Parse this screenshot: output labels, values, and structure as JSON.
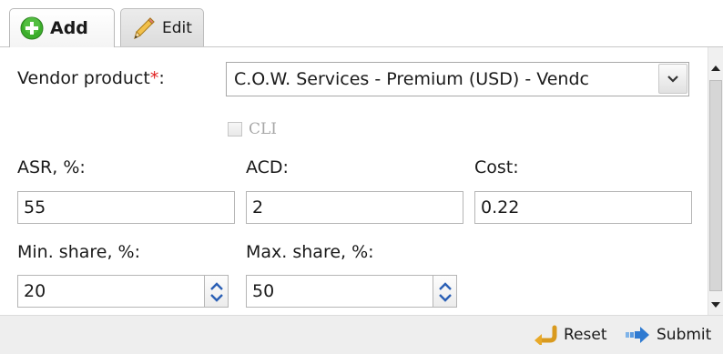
{
  "tabs": {
    "add_label": "Add",
    "edit_label": "Edit",
    "active": "Add"
  },
  "form": {
    "vendor_product": {
      "label": "Vendor product",
      "required_mark": "*",
      "colon": ":",
      "value": "C.O.W. Services - Premium (USD) - Vendc"
    },
    "cli": {
      "label": "CLI",
      "checked": false,
      "disabled": true
    },
    "asr": {
      "label": "ASR, %:",
      "value": "55"
    },
    "acd": {
      "label": "ACD:",
      "value": "2"
    },
    "cost": {
      "label": "Cost:",
      "value": "0.22"
    },
    "min_share": {
      "label": "Min. share, %:",
      "value": "20"
    },
    "max_share": {
      "label": "Max. share, %:",
      "value": "50"
    }
  },
  "footer": {
    "reset_label": "Reset",
    "submit_label": "Submit"
  },
  "colors": {
    "add_icon_green": "#3cae2c",
    "required_red": "#e02020",
    "spin_arrow_blue": "#2a5fb5"
  },
  "icons": {
    "add": "plus-circle-icon",
    "edit": "pencil-icon",
    "reset": "reset-arrow-icon",
    "submit": "submit-arrow-icon",
    "dropdown": "chevron-down-icon",
    "spin_up": "chevron-up-icon",
    "spin_down": "chevron-down-icon"
  }
}
